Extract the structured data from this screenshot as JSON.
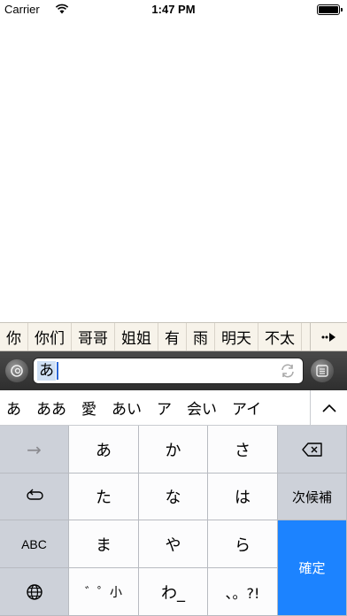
{
  "status_bar": {
    "carrier": "Carrier",
    "time": "1:47 PM"
  },
  "prediction_bar": {
    "items": [
      "你",
      "你们",
      "哥哥",
      "姐姐",
      "有",
      "雨",
      "明天",
      "不太"
    ]
  },
  "input_bar": {
    "value": "あ"
  },
  "candidate_bar": {
    "items": [
      "あ",
      "ああ",
      "愛",
      "あい",
      "ア",
      "会い",
      "アイ"
    ],
    "expand_icon": "chevron-up-icon"
  },
  "keyboard": {
    "row1": {
      "left": "→",
      "keys": [
        "あ",
        "か",
        "さ"
      ],
      "right_icon": "backspace-icon"
    },
    "row2": {
      "left_icon": "undo-icon",
      "keys": [
        "た",
        "な",
        "は"
      ],
      "right": "次候補"
    },
    "row3": {
      "left": "ABC",
      "keys": [
        "ま",
        "や",
        "ら"
      ]
    },
    "row4": {
      "left_icon": "globe-icon",
      "keys": [
        "゛゜小",
        "わ_",
        "、。?!"
      ]
    },
    "confirm": "確定"
  },
  "colors": {
    "confirm_key": "#1c83ff",
    "prediction_bg": "#f7f3ea",
    "input_bar_bg": "#3a3a3a"
  }
}
